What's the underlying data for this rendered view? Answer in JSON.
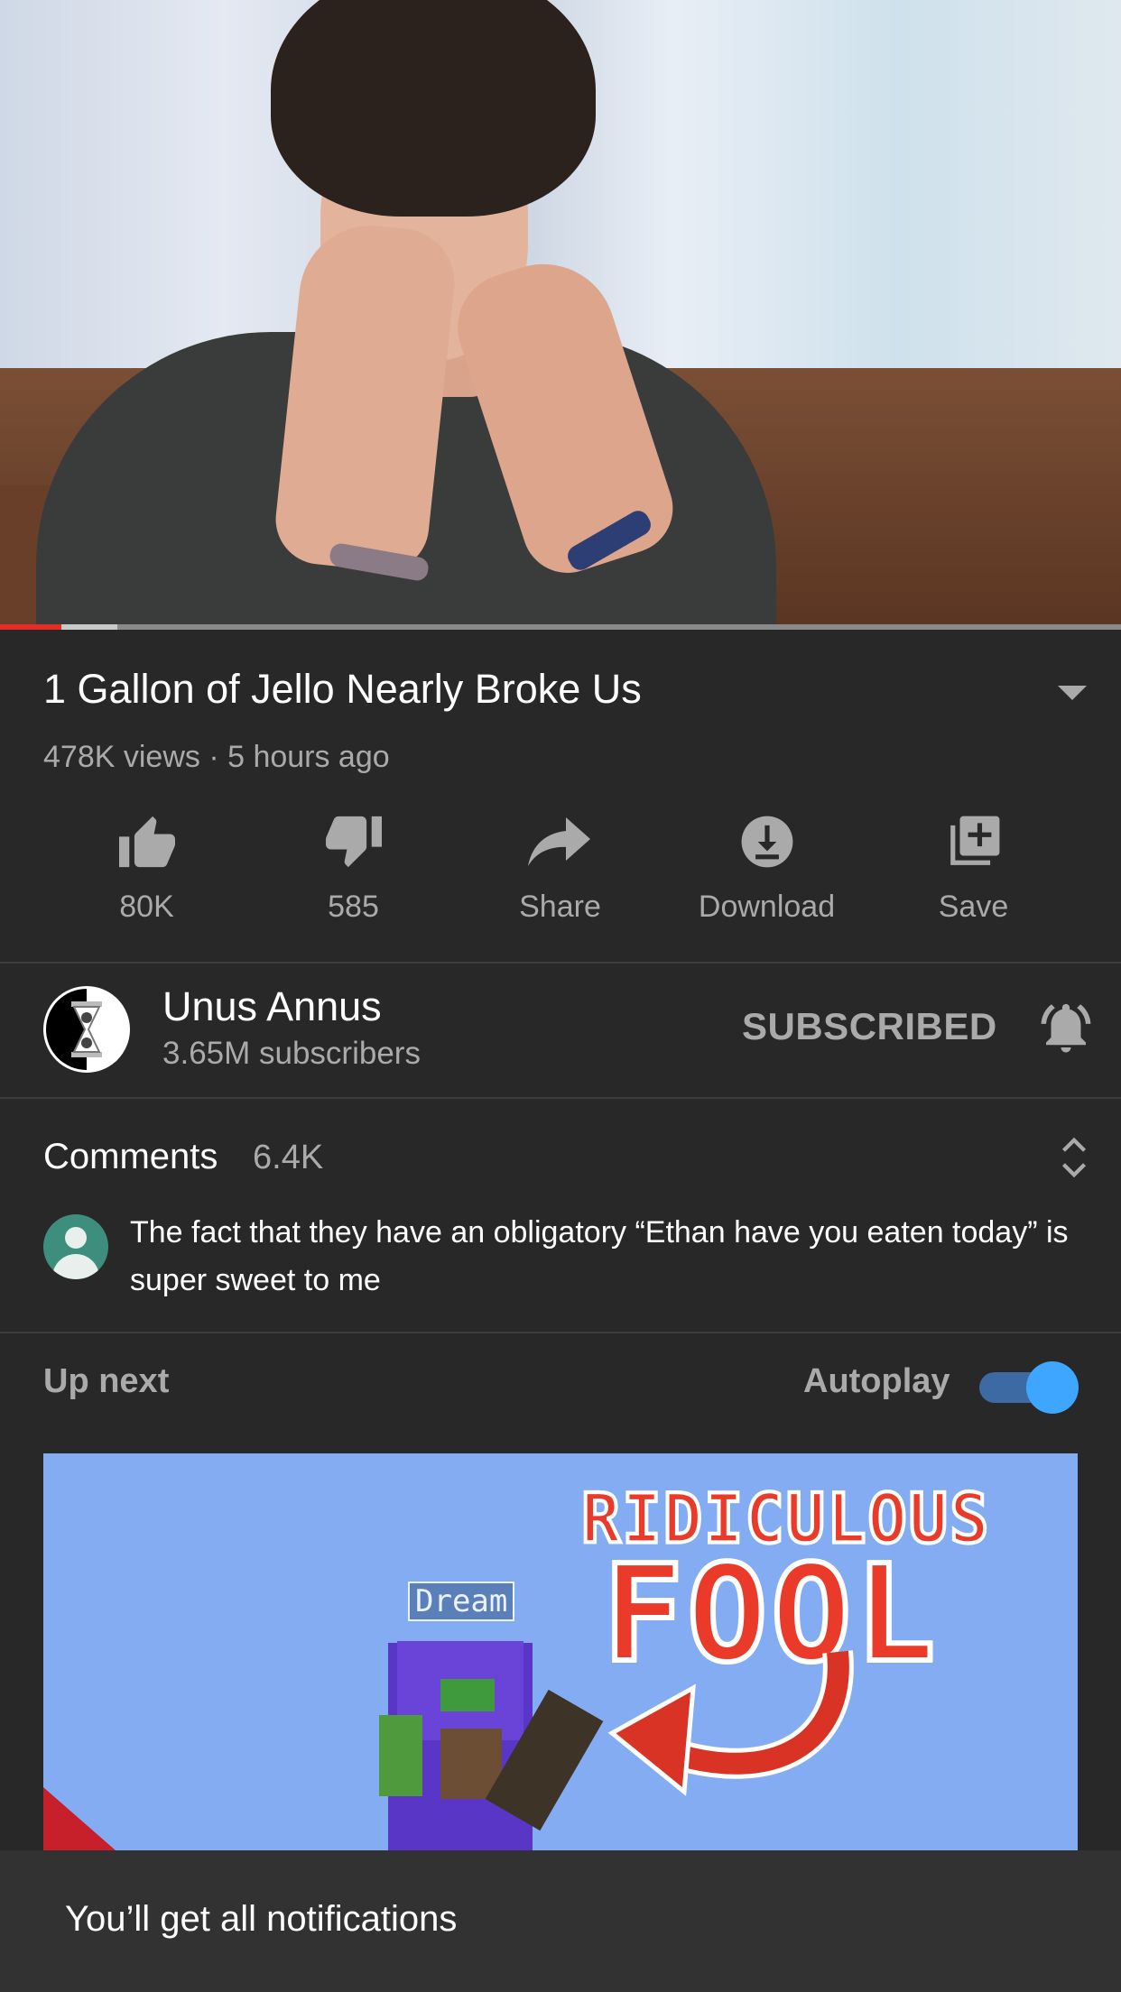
{
  "player": {
    "progress_played_fraction": 0.055,
    "progress_buffered_fraction": 0.105
  },
  "video": {
    "title": "1 Gallon of Jello Nearly Broke Us",
    "meta": "478K views · 5 hours ago"
  },
  "actions": [
    {
      "label": "80K",
      "icon": "thumbs-up-icon"
    },
    {
      "label": "585",
      "icon": "thumbs-down-icon"
    },
    {
      "label": "Share",
      "icon": "share-icon"
    },
    {
      "label": "Download",
      "icon": "download-icon"
    },
    {
      "label": "Save",
      "icon": "add-to-playlist-icon"
    }
  ],
  "channel": {
    "name": "Unus Annus",
    "subscribers": "3.65M subscribers",
    "subscribe_state": "SUBSCRIBED"
  },
  "comments": {
    "title": "Comments",
    "count": "6.4K",
    "top_comment": "The fact that they have an obligatory “Ethan have you eaten today” is super sweet to me"
  },
  "up_next": {
    "label": "Up next",
    "autoplay_label": "Autoplay",
    "autoplay_on": true,
    "thumbnail_text_1": "RIDICULOUS",
    "thumbnail_text_2": "FOOL",
    "thumbnail_nametag": "Dream"
  },
  "snackbar": {
    "text": "You’ll get all notifications"
  },
  "colors": {
    "background": "#282828",
    "progress_played": "#e52d27",
    "toggle_on": "#3ea6ff"
  }
}
